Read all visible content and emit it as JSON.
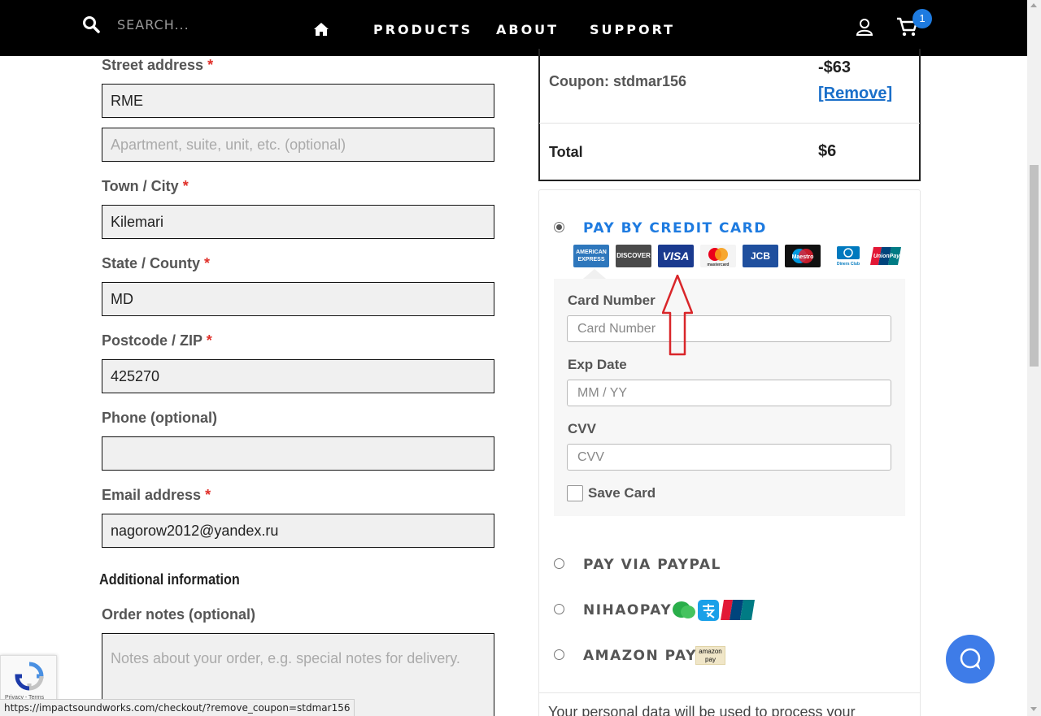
{
  "header": {
    "search_placeholder": "SEARCH...",
    "nav": [
      "PRODUCTS",
      "ABOUT",
      "SUPPORT"
    ],
    "cart_count": "1"
  },
  "billing": {
    "street_label": "Street address",
    "street_value": "RME",
    "street2_placeholder": "Apartment, suite, unit, etc. (optional)",
    "city_label": "Town / City",
    "city_value": "Kilemari",
    "state_label": "State / County",
    "state_value": "MD",
    "zip_label": "Postcode / ZIP",
    "zip_value": "425270",
    "phone_label": "Phone (optional)",
    "phone_value": "",
    "email_label": "Email address",
    "email_value": "nagorow2012@yandex.ru",
    "required_mark": "*"
  },
  "additional": {
    "heading": "Additional information",
    "notes_label": "Order notes (optional)",
    "notes_placeholder": "Notes about your order, e.g. special notes for delivery."
  },
  "summary": {
    "coupon_label": "Coupon: stdmar156",
    "coupon_amount": "-$63",
    "coupon_remove": "[Remove]",
    "total_label": "Total",
    "total_value": "$6"
  },
  "payment": {
    "credit_card_label": "PAY BY CREDIT CARD",
    "card_brands": [
      "AMERICAN EXPRESS",
      "DISCOVER",
      "VISA",
      "mastercard",
      "JCB",
      "Maestro",
      "Diners Club",
      "UnionPay"
    ],
    "card_number_label": "Card Number",
    "card_number_placeholder": "Card Number",
    "exp_label": "Exp Date",
    "exp_placeholder": "MM / YY",
    "cvv_label": "CVV",
    "cvv_placeholder": "CVV",
    "save_card_label": "Save Card",
    "paypal_label": "PAY VIA PAYPAL",
    "nihaopay_label": "NIHAOPAY",
    "amazon_label": "AMAZON PAY",
    "amazon_badge_line1": "amazon",
    "amazon_badge_line2": "pay",
    "privacy_text": "Your personal data will be used to process your"
  },
  "recaptcha": {
    "text": "Privacy - Terms"
  },
  "statusbar": {
    "url": "https://impactsoundworks.com/checkout/?remove_coupon=stdmar156"
  },
  "colors": {
    "accent": "#1e7be0",
    "required": "#e0302a",
    "chat": "#3e7ce8"
  }
}
